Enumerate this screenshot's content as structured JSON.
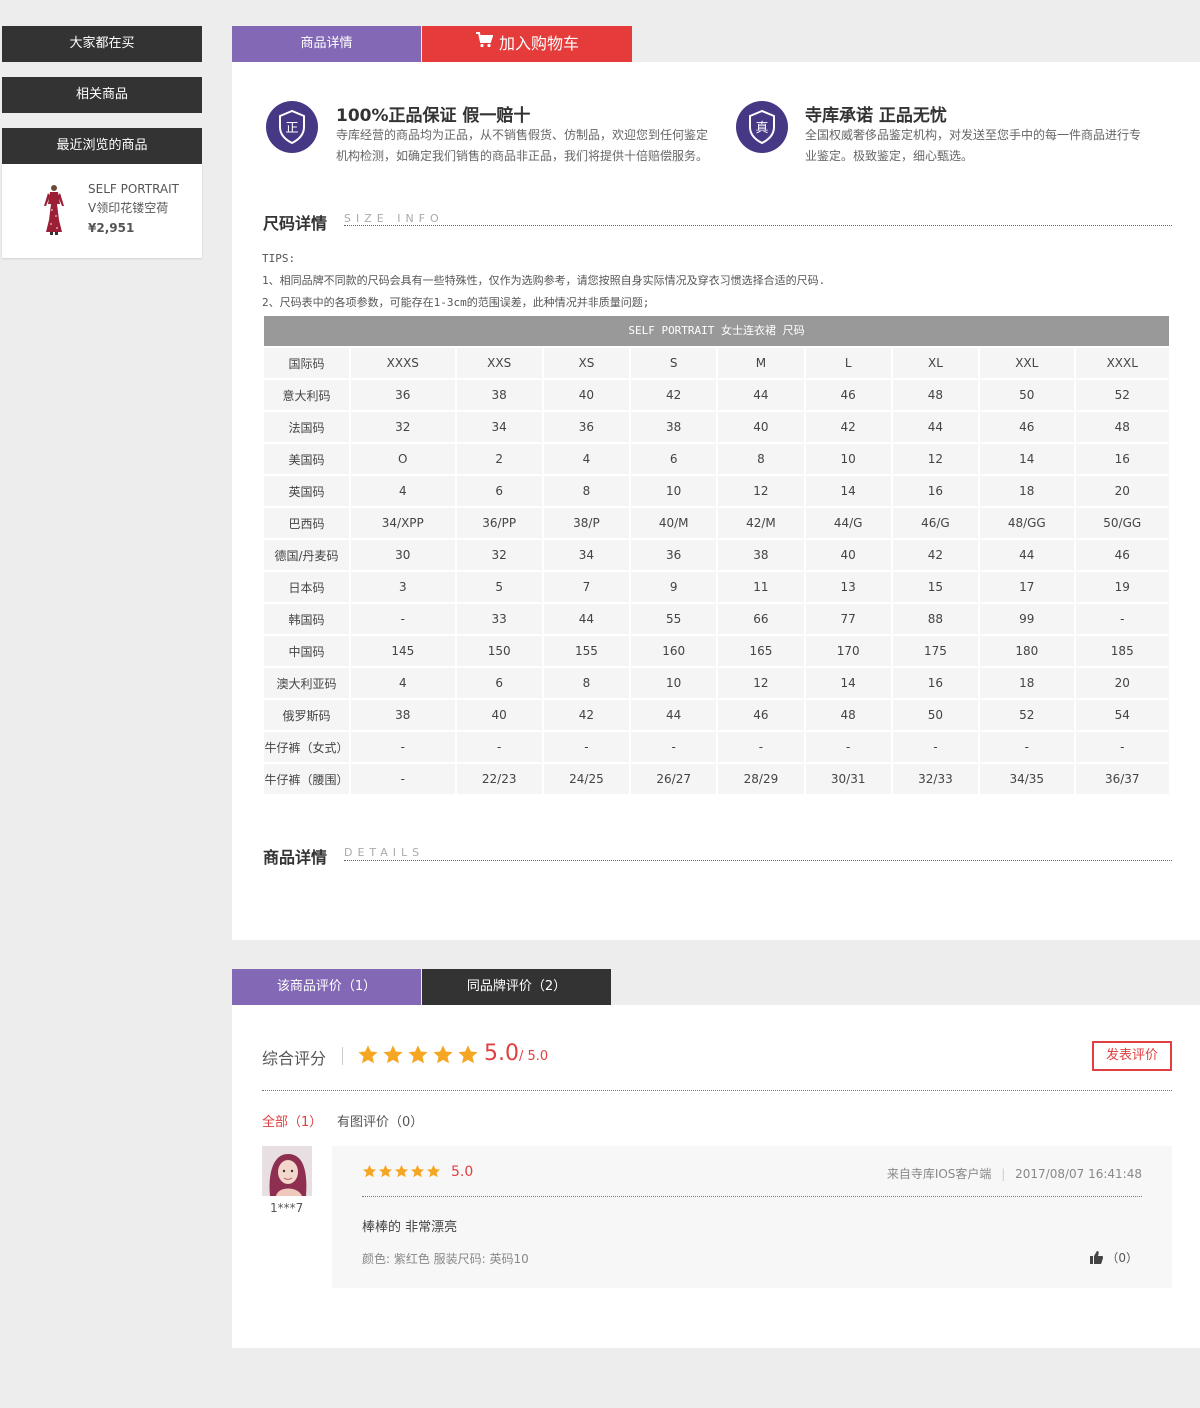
{
  "sidebar": {
    "popular_label": "大家都在买",
    "related_label": "相关商品",
    "recent_label": "最近浏览的商品",
    "recent_item": {
      "brand": "SELF PORTRAIT",
      "name": "V领印花镂空荷",
      "price": "¥2,951"
    }
  },
  "top_tabs": {
    "details_label": "商品详情",
    "cart_label": "加入购物车"
  },
  "promises": [
    {
      "icon_char": "正",
      "title": "100%正品保证 假一赔十",
      "desc_line1": "寺库经营的商品均为正品，从不销售假货、仿制品，欢迎您到任何鉴定",
      "desc_line2": "机构检测，如确定我们销售的商品非正品，我们将提供十倍赔偿服务。"
    },
    {
      "icon_char": "真",
      "title": "寺库承诺 正品无忧",
      "desc_line1": "全国权威奢侈品鉴定机构，对发送至您手中的每一件商品进行专",
      "desc_line2": "业鉴定。极致鉴定，细心甄选。"
    }
  ],
  "size_section": {
    "title": "尺码详情",
    "subtitle": "SIZE INFO",
    "tips_head": "TIPS:",
    "tip1": "1、相同品牌不同款的尺码会具有一些特殊性，仅作为选购参考，请您按照自身实际情况及穿衣习惯选择合适的尺码.",
    "tip2": "2、尺码表中的各项参数，可能存在1-3cm的范围误差，此种情况并非质量问题;",
    "table_caption": "SELF PORTRAIT 女士连衣裙 尺码",
    "rows": [
      {
        "label": "国际码",
        "cells": [
          "XXXS",
          "XXS",
          "XS",
          "S",
          "M",
          "L",
          "XL",
          "XXL",
          "XXXL"
        ]
      },
      {
        "label": "意大利码",
        "cells": [
          "36",
          "38",
          "40",
          "42",
          "44",
          "46",
          "48",
          "50",
          "52"
        ]
      },
      {
        "label": "法国码",
        "cells": [
          "32",
          "34",
          "36",
          "38",
          "40",
          "42",
          "44",
          "46",
          "48"
        ]
      },
      {
        "label": "美国码",
        "cells": [
          "O",
          "2",
          "4",
          "6",
          "8",
          "10",
          "12",
          "14",
          "16"
        ]
      },
      {
        "label": "英国码",
        "cells": [
          "4",
          "6",
          "8",
          "10",
          "12",
          "14",
          "16",
          "18",
          "20"
        ]
      },
      {
        "label": "巴西码",
        "cells": [
          "34/XPP",
          "36/PP",
          "38/P",
          "40/M",
          "42/M",
          "44/G",
          "46/G",
          "48/GG",
          "50/GG"
        ]
      },
      {
        "label": "德国/丹麦码",
        "cells": [
          "30",
          "32",
          "34",
          "36",
          "38",
          "40",
          "42",
          "44",
          "46"
        ]
      },
      {
        "label": "日本码",
        "cells": [
          "3",
          "5",
          "7",
          "9",
          "11",
          "13",
          "15",
          "17",
          "19"
        ]
      },
      {
        "label": "韩国码",
        "cells": [
          "-",
          "33",
          "44",
          "55",
          "66",
          "77",
          "88",
          "99",
          "-"
        ]
      },
      {
        "label": "中国码",
        "cells": [
          "145",
          "150",
          "155",
          "160",
          "165",
          "170",
          "175",
          "180",
          "185"
        ]
      },
      {
        "label": "澳大利亚码",
        "cells": [
          "4",
          "6",
          "8",
          "10",
          "12",
          "14",
          "16",
          "18",
          "20"
        ]
      },
      {
        "label": "俄罗斯码",
        "cells": [
          "38",
          "40",
          "42",
          "44",
          "46",
          "48",
          "50",
          "52",
          "54"
        ]
      },
      {
        "label": "牛仔裤（女式）",
        "cells": [
          "-",
          "-",
          "-",
          "-",
          "-",
          "-",
          "-",
          "-",
          "-"
        ]
      },
      {
        "label": "牛仔裤（腰围）",
        "cells": [
          "-",
          "22/23",
          "24/25",
          "26/27",
          "28/29",
          "30/31",
          "32/33",
          "34/35",
          "36/37"
        ]
      }
    ]
  },
  "details_section": {
    "title": "商品详情",
    "subtitle": "DETAILS"
  },
  "review_tabs": {
    "product_reviews": "该商品评价（1）",
    "brand_reviews": "同品牌评价（2）"
  },
  "reviews": {
    "overall_label": "综合评分",
    "score": "5.0",
    "score_total": "/ 5.0",
    "stars": 5,
    "post_label": "发表评价",
    "filter_all": "全部（1）",
    "filter_photo": "有图评价（0）",
    "items": [
      {
        "user": "1***7",
        "score": "5.0",
        "source": "来自寺库IOS客户端",
        "date": "2017/08/07 16:41:48",
        "text": "棒棒的 非常漂亮",
        "attrs": "颜色: 紫红色 服装尺码: 英码10",
        "likes": "（0）"
      }
    ]
  },
  "colors": {
    "purple": "#8368b5",
    "red": "#e53b3b",
    "dark": "#333333",
    "star": "#f5a623",
    "accent_red": "#e04040"
  }
}
